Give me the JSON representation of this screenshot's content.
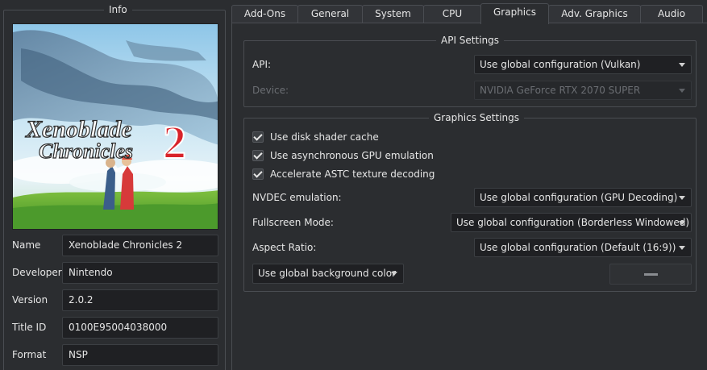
{
  "info": {
    "title": "Info",
    "cover": {
      "logo_line1": "Xenoblade",
      "logo_line2": "Chronicles",
      "logo_number": "2"
    },
    "fields": [
      {
        "label": "Name",
        "value": "Xenoblade Chronicles 2"
      },
      {
        "label": "Developer",
        "value": "Nintendo"
      },
      {
        "label": "Version",
        "value": "2.0.2"
      },
      {
        "label": "Title ID",
        "value": "0100E95004038000"
      },
      {
        "label": "Format",
        "value": "NSP"
      }
    ]
  },
  "tabs": [
    {
      "label": "Add-Ons"
    },
    {
      "label": "General"
    },
    {
      "label": "System"
    },
    {
      "label": "CPU"
    },
    {
      "label": "Graphics",
      "active": true
    },
    {
      "label": "Adv. Graphics"
    },
    {
      "label": "Audio"
    }
  ],
  "api_settings": {
    "title": "API Settings",
    "api_label": "API:",
    "api_value": "Use global configuration (Vulkan)",
    "device_label": "Device:",
    "device_value": "NVIDIA GeForce RTX 2070 SUPER"
  },
  "graphics_settings": {
    "title": "Graphics Settings",
    "checkboxes": [
      {
        "label": "Use disk shader cache",
        "checked": true
      },
      {
        "label": "Use asynchronous GPU emulation",
        "checked": true
      },
      {
        "label": "Accelerate ASTC texture decoding",
        "checked": true
      }
    ],
    "nvdec_label": "NVDEC emulation:",
    "nvdec_value": "Use global configuration (GPU Decoding)",
    "fullscreen_label": "Fullscreen Mode:",
    "fullscreen_value": "Use global configuration (Borderless Windowed)",
    "aspect_label": "Aspect Ratio:",
    "aspect_value": "Use global configuration (Default (16:9))",
    "bg_color_value": "Use global background color",
    "bg_color_swatch": "#8a8d91"
  },
  "colors": {
    "background": "#2b2d30",
    "field_bg": "#1f2023",
    "border": "#4a4d52",
    "text": "#e6e6e6",
    "disabled_text": "#6b6e73"
  }
}
